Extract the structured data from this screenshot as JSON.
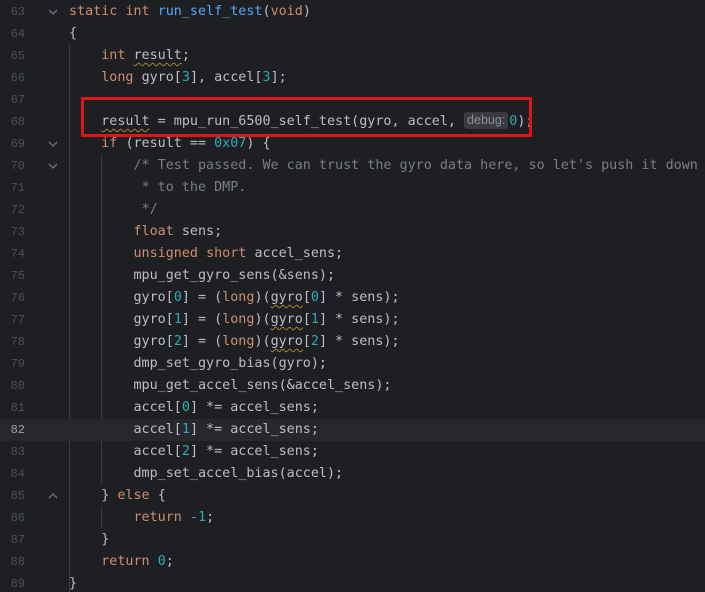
{
  "editor": {
    "lines": [
      {
        "number": "63",
        "fold": "v",
        "tokens": [
          {
            "t": "static ",
            "c": "kw"
          },
          {
            "t": "int ",
            "c": "kw"
          },
          {
            "t": "run_self_test",
            "c": "fn"
          },
          {
            "t": "(",
            "c": "pl"
          },
          {
            "t": "void",
            "c": "kw"
          },
          {
            "t": ")",
            "c": "pl"
          }
        ]
      },
      {
        "number": "64",
        "tokens": [
          {
            "t": "{",
            "c": "pl"
          }
        ]
      },
      {
        "number": "65",
        "tokens": [
          {
            "t": "    ",
            "c": "pl"
          },
          {
            "t": "int ",
            "c": "kw"
          },
          {
            "t": "result",
            "c": "pl squig"
          },
          {
            "t": ";",
            "c": "pl"
          }
        ]
      },
      {
        "number": "66",
        "tokens": [
          {
            "t": "    ",
            "c": "pl"
          },
          {
            "t": "long ",
            "c": "kw"
          },
          {
            "t": "gyro[",
            "c": "pl"
          },
          {
            "t": "3",
            "c": "num"
          },
          {
            "t": "], accel[",
            "c": "pl"
          },
          {
            "t": "3",
            "c": "num"
          },
          {
            "t": "];",
            "c": "pl"
          }
        ]
      },
      {
        "number": "67",
        "tokens": []
      },
      {
        "number": "68",
        "tokens": [
          {
            "t": "    ",
            "c": "pl"
          },
          {
            "t": "result",
            "c": "pl squig"
          },
          {
            "t": " = mpu_run_6500_self_test(gyro, accel, ",
            "c": "pl"
          },
          {
            "hint": "debug:",
            "value": "0"
          },
          {
            "t": ");",
            "c": "pl"
          }
        ]
      },
      {
        "number": "69",
        "fold": "v",
        "tokens": [
          {
            "t": "    ",
            "c": "pl"
          },
          {
            "t": "if ",
            "c": "kw"
          },
          {
            "t": "(result == ",
            "c": "pl"
          },
          {
            "t": "0x07",
            "c": "num"
          },
          {
            "t": ") {",
            "c": "pl"
          }
        ]
      },
      {
        "number": "70",
        "fold": "v",
        "tokens": [
          {
            "t": "        ",
            "c": "pl"
          },
          {
            "t": "/* Test passed. We can trust the gyro data here, so let's push it down",
            "c": "cm"
          }
        ]
      },
      {
        "number": "71",
        "tokens": [
          {
            "t": "         ",
            "c": "pl"
          },
          {
            "t": "* to the DMP.",
            "c": "cm"
          }
        ]
      },
      {
        "number": "72",
        "tokens": [
          {
            "t": "         ",
            "c": "pl"
          },
          {
            "t": "*/",
            "c": "cm"
          }
        ]
      },
      {
        "number": "73",
        "tokens": [
          {
            "t": "        ",
            "c": "pl"
          },
          {
            "t": "float ",
            "c": "kw"
          },
          {
            "t": "sens;",
            "c": "pl"
          }
        ]
      },
      {
        "number": "74",
        "tokens": [
          {
            "t": "        ",
            "c": "pl"
          },
          {
            "t": "unsigned ",
            "c": "kw"
          },
          {
            "t": "short ",
            "c": "kw"
          },
          {
            "t": "accel_sens;",
            "c": "pl"
          }
        ]
      },
      {
        "number": "75",
        "tokens": [
          {
            "t": "        mpu_get_gyro_sens(&sens);",
            "c": "pl"
          }
        ]
      },
      {
        "number": "76",
        "tokens": [
          {
            "t": "        gyro[",
            "c": "pl"
          },
          {
            "t": "0",
            "c": "num"
          },
          {
            "t": "] = (",
            "c": "pl"
          },
          {
            "t": "long",
            "c": "kw"
          },
          {
            "t": ")(",
            "c": "pl"
          },
          {
            "t": "gyro",
            "c": "pl squig"
          },
          {
            "t": "[",
            "c": "pl"
          },
          {
            "t": "0",
            "c": "num"
          },
          {
            "t": "] * sens);",
            "c": "pl"
          }
        ]
      },
      {
        "number": "77",
        "tokens": [
          {
            "t": "        gyro[",
            "c": "pl"
          },
          {
            "t": "1",
            "c": "num"
          },
          {
            "t": "] = (",
            "c": "pl"
          },
          {
            "t": "long",
            "c": "kw"
          },
          {
            "t": ")(",
            "c": "pl"
          },
          {
            "t": "gyro",
            "c": "pl squig"
          },
          {
            "t": "[",
            "c": "pl"
          },
          {
            "t": "1",
            "c": "num"
          },
          {
            "t": "] * sens);",
            "c": "pl"
          }
        ]
      },
      {
        "number": "78",
        "tokens": [
          {
            "t": "        gyro[",
            "c": "pl"
          },
          {
            "t": "2",
            "c": "num"
          },
          {
            "t": "] = (",
            "c": "pl"
          },
          {
            "t": "long",
            "c": "kw"
          },
          {
            "t": ")(",
            "c": "pl"
          },
          {
            "t": "gyro",
            "c": "pl squig"
          },
          {
            "t": "[",
            "c": "pl"
          },
          {
            "t": "2",
            "c": "num"
          },
          {
            "t": "] * sens);",
            "c": "pl"
          }
        ]
      },
      {
        "number": "79",
        "tokens": [
          {
            "t": "        dmp_set_gyro_bias(gyro);",
            "c": "pl"
          }
        ]
      },
      {
        "number": "80",
        "tokens": [
          {
            "t": "        mpu_get_accel_sens(&accel_sens);",
            "c": "pl"
          }
        ]
      },
      {
        "number": "81",
        "tokens": [
          {
            "t": "        accel[",
            "c": "pl"
          },
          {
            "t": "0",
            "c": "num"
          },
          {
            "t": "] *= accel_sens;",
            "c": "pl"
          }
        ]
      },
      {
        "number": "82",
        "current": true,
        "tokens": [
          {
            "t": "        accel[",
            "c": "pl"
          },
          {
            "t": "1",
            "c": "num"
          },
          {
            "t": "] *= accel_sens;",
            "c": "pl"
          }
        ]
      },
      {
        "number": "83",
        "tokens": [
          {
            "t": "        accel[",
            "c": "pl"
          },
          {
            "t": "2",
            "c": "num"
          },
          {
            "t": "] *= accel_sens;",
            "c": "pl"
          }
        ]
      },
      {
        "number": "84",
        "tokens": [
          {
            "t": "        dmp_set_accel_bias(accel);",
            "c": "pl"
          }
        ]
      },
      {
        "number": "85",
        "fold": "^",
        "tokens": [
          {
            "t": "    } ",
            "c": "pl"
          },
          {
            "t": "else ",
            "c": "kw"
          },
          {
            "t": "{",
            "c": "pl"
          }
        ]
      },
      {
        "number": "86",
        "tokens": [
          {
            "t": "        ",
            "c": "pl"
          },
          {
            "t": "return ",
            "c": "kw"
          },
          {
            "t": "-1",
            "c": "num"
          },
          {
            "t": ";",
            "c": "pl"
          }
        ]
      },
      {
        "number": "87",
        "tokens": [
          {
            "t": "    }",
            "c": "pl"
          }
        ]
      },
      {
        "number": "88",
        "tokens": [
          {
            "t": "    ",
            "c": "pl"
          },
          {
            "t": "return ",
            "c": "kw"
          },
          {
            "t": "0",
            "c": "num"
          },
          {
            "t": ";",
            "c": "pl"
          }
        ]
      },
      {
        "number": "89",
        "tokens": [
          {
            "t": "}",
            "c": "pl"
          }
        ]
      }
    ]
  },
  "colors": {
    "background": "#1e1f22",
    "current_line": "#26282e",
    "keyword": "#cf8e6d",
    "function": "#56a8f5",
    "number": "#2aacb8",
    "comment": "#7a7e85",
    "annotation_box": "#e0151b"
  },
  "icons": {
    "fold_expanded": "chevron-down-icon",
    "fold_end": "chevron-up-icon"
  }
}
